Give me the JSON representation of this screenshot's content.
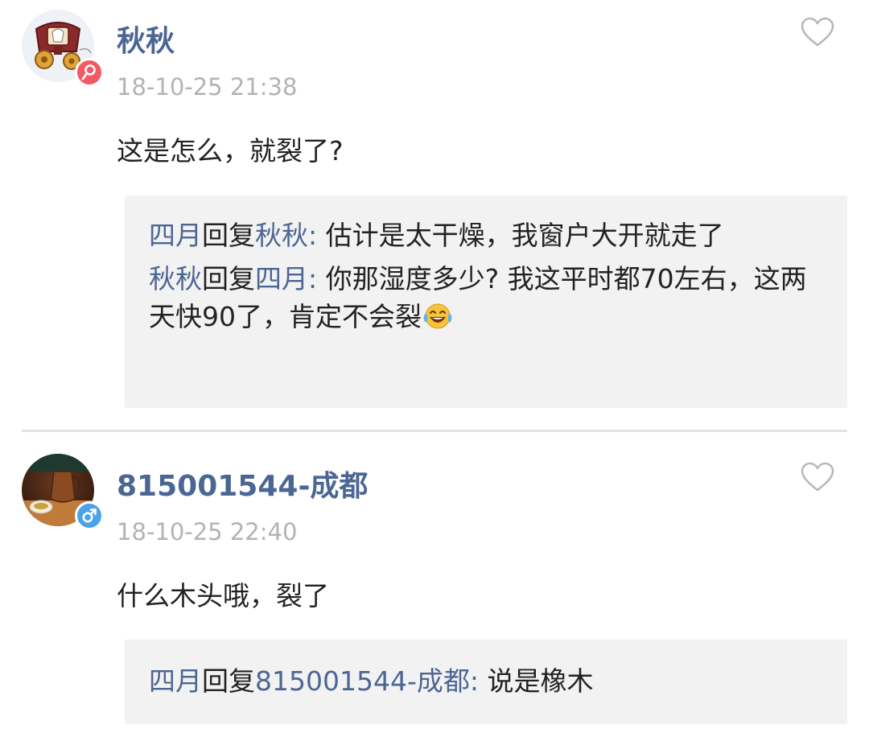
{
  "comments": [
    {
      "username": "秋秋",
      "gender": "female",
      "gender_symbol": "♀",
      "gender_color": "#f25a66",
      "timestamp": "18-10-25 21:38",
      "content": "这是怎么，就裂了?",
      "avatar_icon": "carriage-icon",
      "replies": [
        {
          "from": "四月",
          "verb": "回复",
          "to": "秋秋",
          "colon": ":",
          "text": " 估计是太干燥，我窗户大开就走了"
        },
        {
          "from": "秋秋",
          "verb": "回复",
          "to": "四月",
          "colon": ":",
          "text": " 你那湿度多少? 我这平时都70左右，这两天快90了，肯定不会裂",
          "emoji": "laughing-crying-emoji"
        }
      ]
    },
    {
      "username": "815001544-成都",
      "gender": "male",
      "gender_symbol": "♂",
      "gender_color": "#4aa3e8",
      "timestamp": "18-10-25 22:40",
      "content": "什么木头哦，裂了",
      "avatar_icon": "teapot-icon",
      "replies": [
        {
          "from": "四月",
          "verb": "回复",
          "to": "815001544-成都",
          "colon": ":",
          "text": " 说是橡木"
        }
      ]
    }
  ],
  "colors": {
    "username": "#4c6694",
    "timestamp": "#b3b3b3",
    "reply_bg": "#f2f2f2",
    "divider": "#e3e3e3",
    "like_icon": "#b8b8b8"
  },
  "icons": {
    "like": "heart-outline-icon"
  }
}
